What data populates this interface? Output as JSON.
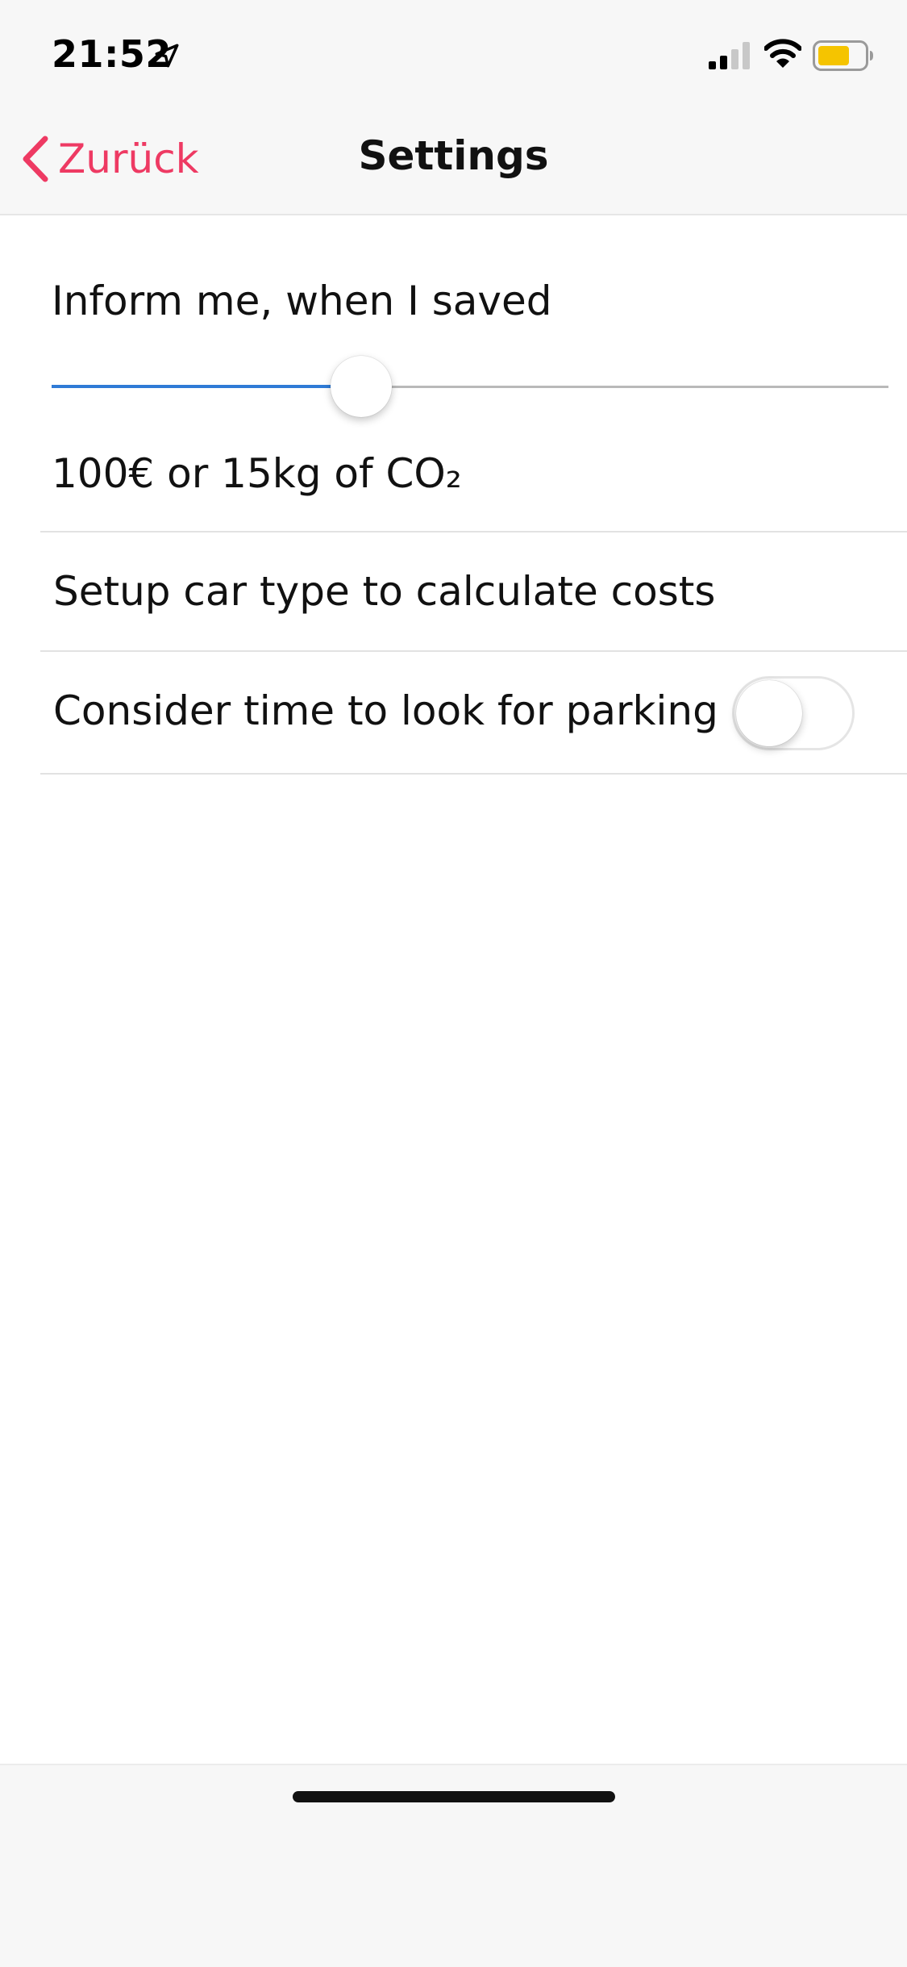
{
  "status_bar": {
    "time": "21:52",
    "icons": [
      "location-arrow-icon",
      "cellular-signal-icon",
      "wifi-icon",
      "battery-icon"
    ],
    "battery_color": "#f5c400"
  },
  "navigation": {
    "back_label": "Zurück",
    "title": "Settings",
    "accent_color": "#ee3a63"
  },
  "settings": {
    "inform_label": "Inform me, when I saved",
    "slider": {
      "level": 0.37,
      "fill_color": "#2f7bd6"
    },
    "threshold_label": "100€ or 15kg of CO₂",
    "car_type_label": "Setup car type to calculate costs",
    "parking_label": "Consider time to look for parking",
    "parking_toggle_on": false
  }
}
